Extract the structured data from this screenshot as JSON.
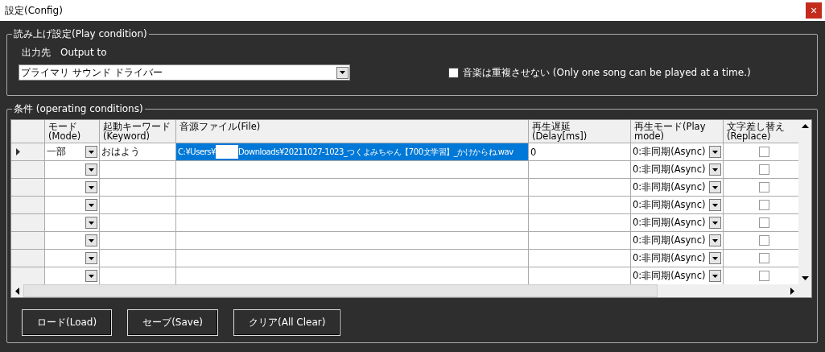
{
  "window": {
    "title": "設定(Config)",
    "close": "×"
  },
  "play_condition": {
    "title": "読み上げ設定(Play condition)",
    "output_label": "出力先　Output to",
    "output_device": "プライマリ サウンド ドライバー",
    "no_overlap": {
      "label": "音楽は重複させない (Only one song can be played at a time.)",
      "checked": false
    }
  },
  "conditions": {
    "title": "条件 (operating conditions)",
    "columns": [
      "モード\n(Mode)",
      "起動キーワード(Keyword)",
      "音源ファイル(File)",
      "再生遅延\n(Delay[ms])",
      "再生モード(Play\nmode)",
      "文字差し替え\n(Replace)"
    ],
    "rows": [
      {
        "current": true,
        "mode": "一部",
        "keyword": "おはよう",
        "file": {
          "before": "C:¥Users¥",
          "redacted": true,
          "after": "Downloads¥20211027-1023_つくよみちゃん【700文学習】_かけからね.wav",
          "selected": true
        },
        "delay": "0",
        "play_mode": "0:非同期(Async)",
        "replace": false
      },
      {
        "current": false,
        "play_mode": "0:非同期(Async)",
        "replace": false
      },
      {
        "current": false,
        "play_mode": "0:非同期(Async)",
        "replace": false
      },
      {
        "current": false,
        "play_mode": "0:非同期(Async)",
        "replace": false
      },
      {
        "current": false,
        "play_mode": "0:非同期(Async)",
        "replace": false
      },
      {
        "current": false,
        "play_mode": "0:非同期(Async)",
        "replace": false
      },
      {
        "current": false,
        "play_mode": "0:非同期(Async)",
        "replace": false
      },
      {
        "current": false,
        "play_mode": "0:非同期(Async)",
        "replace": false
      }
    ]
  },
  "buttons": [
    "ロード(Load)",
    "セーブ(Save)",
    "クリア(All Clear)"
  ]
}
